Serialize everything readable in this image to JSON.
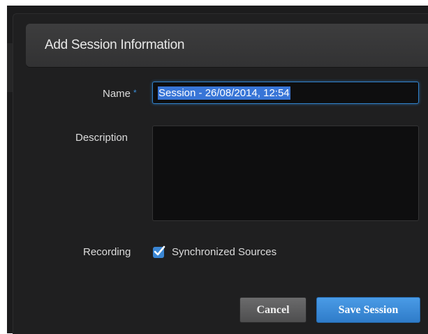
{
  "dialog": {
    "title": "Add Session Information"
  },
  "form": {
    "name_label": "Name",
    "required_marker": "*",
    "name_value": "Session - 26/08/2014, 12:54",
    "description_label": "Description",
    "description_value": "",
    "recording_label": "Recording",
    "synchronized_sources_label": "Synchronized Sources",
    "synchronized_sources_checked": true
  },
  "buttons": {
    "cancel_label": "Cancel",
    "save_label": "Save Session"
  },
  "colors": {
    "accent": "#3a86d4",
    "dialog_bg": "#1f1f20",
    "input_bg": "#0e0e0f",
    "selection": "#3875d7"
  },
  "icons": {
    "checkbox": "checkmark-icon"
  }
}
